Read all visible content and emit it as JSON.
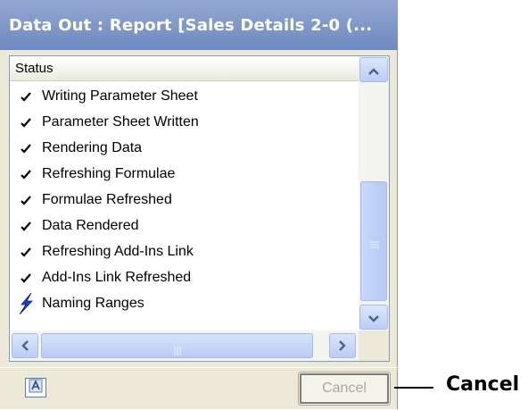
{
  "window": {
    "title": "Data Out : Report [Sales Details 2-0 (..."
  },
  "list": {
    "column_header": "Status",
    "items": [
      {
        "label": "Writing Parameter Sheet",
        "icon": "checkmark-icon"
      },
      {
        "label": "Parameter Sheet Written",
        "icon": "checkmark-icon"
      },
      {
        "label": "Rendering Data",
        "icon": "checkmark-icon"
      },
      {
        "label": "Refreshing Formulae",
        "icon": "checkmark-icon"
      },
      {
        "label": "Formulae Refreshed",
        "icon": "checkmark-icon"
      },
      {
        "label": "Data Rendered",
        "icon": "checkmark-icon"
      },
      {
        "label": "Refreshing Add-Ins Link",
        "icon": "checkmark-icon"
      },
      {
        "label": "Add-Ins Link Refreshed",
        "icon": "checkmark-icon"
      },
      {
        "label": "Naming Ranges",
        "icon": "lightning-icon"
      }
    ]
  },
  "buttons": {
    "cancel_label": "Cancel"
  },
  "annotation": {
    "label": "Cancel"
  },
  "colors": {
    "titlebar": "#7d94c7",
    "lightning": "#1a3fd6"
  }
}
